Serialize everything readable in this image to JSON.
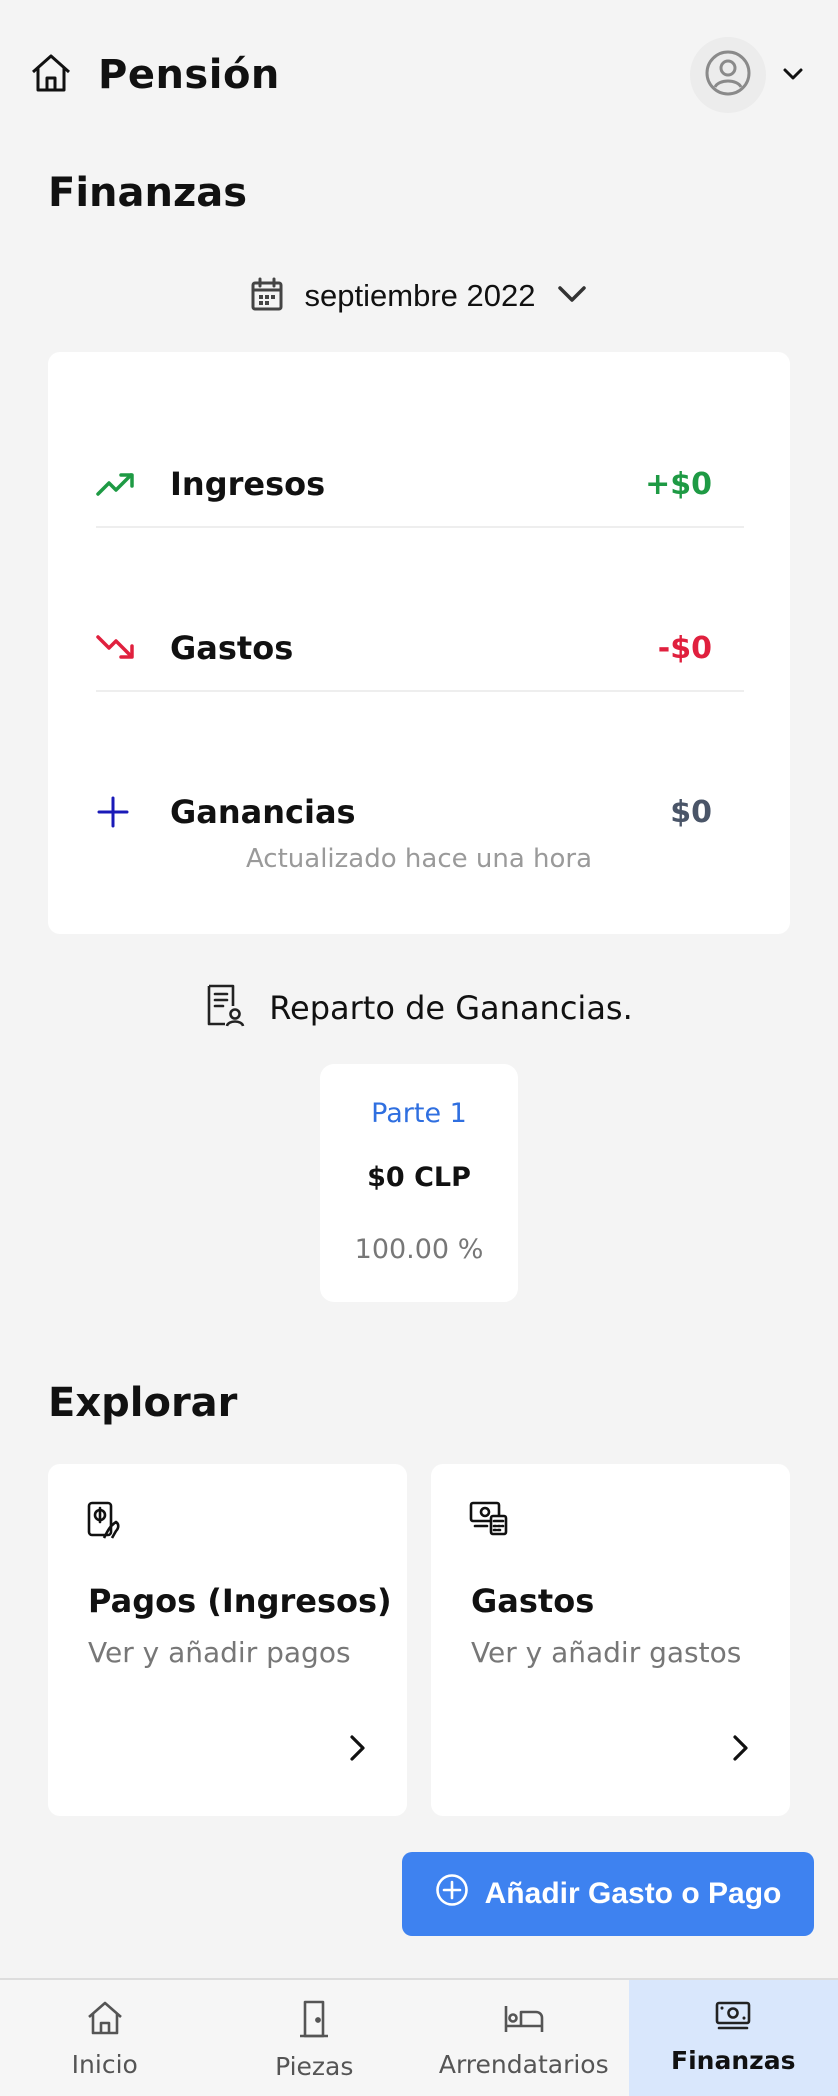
{
  "header": {
    "app_title": "Pensión",
    "home_icon": "home-icon",
    "avatar_icon": "user-circle-icon",
    "menu_icon": "chevron-down-icon"
  },
  "finances": {
    "title": "Finanzas",
    "month": "septiembre 2022",
    "summary": {
      "income_label": "Ingresos",
      "income_value": "+$0",
      "expenses_label": "Gastos",
      "expenses_value": "-$0",
      "profit_label": "Ganancias",
      "profit_value": "$0",
      "updated_text": "Actualizado hace una hora"
    }
  },
  "split": {
    "heading": "Reparto de Ganancias.",
    "parts": [
      {
        "name": "Parte 1",
        "amount": "$0 CLP",
        "percent": "100.00 %"
      }
    ]
  },
  "explore": {
    "title": "Explorar",
    "cards": [
      {
        "title": "Pagos (Ingresos)",
        "subtitle": "Ver y añadir pagos"
      },
      {
        "title": "Gastos",
        "subtitle": "Ver y añadir gastos"
      }
    ]
  },
  "fab": {
    "label": "Añadir Gasto o Pago"
  },
  "nav": {
    "items": [
      {
        "label": "Inicio"
      },
      {
        "label": "Piezas"
      },
      {
        "label": "Arrendatarios"
      },
      {
        "label": "Finanzas"
      }
    ],
    "active": "Finanzas"
  },
  "colors": {
    "income": "#1e9a44",
    "expense": "#e0203e",
    "profit_icon": "#1a1ab8",
    "profit_value": "#4a5568",
    "accent": "#3e82f0",
    "active_nav_bg": "#d9e7fc"
  }
}
